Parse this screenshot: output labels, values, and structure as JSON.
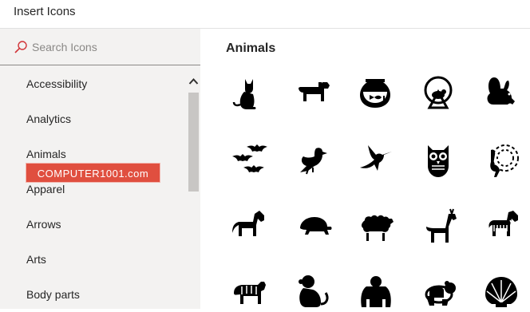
{
  "window": {
    "title": "Insert Icons"
  },
  "search": {
    "placeholder": "Search Icons",
    "value": ""
  },
  "categories": [
    "Accessibility",
    "Analytics",
    "Animals",
    "Apparel",
    "Arrows",
    "Arts",
    "Body parts"
  ],
  "watermark": "COMPUTER1001.com",
  "main": {
    "section_title": "Animals",
    "icons": [
      [
        "cat-icon",
        "dog-icon",
        "fishbowl-icon",
        "hamster-wheel-icon",
        "rabbit-icon"
      ],
      [
        "bats-icon",
        "bird-icon",
        "hummingbird-icon",
        "owl-icon",
        "peacock-icon"
      ],
      [
        "horse-icon",
        "turtle-icon",
        "sheep-icon",
        "deer-icon",
        "zebra-icon"
      ],
      [
        "tiger-icon",
        "monkey-icon",
        "gorilla-icon",
        "panda-icon",
        "shell-icon"
      ]
    ]
  },
  "colors": {
    "accent": "#d13438",
    "icon": "#000000",
    "sidebar_bg": "#f3f2f1",
    "scroll_thumb": "#c8c6c4"
  }
}
